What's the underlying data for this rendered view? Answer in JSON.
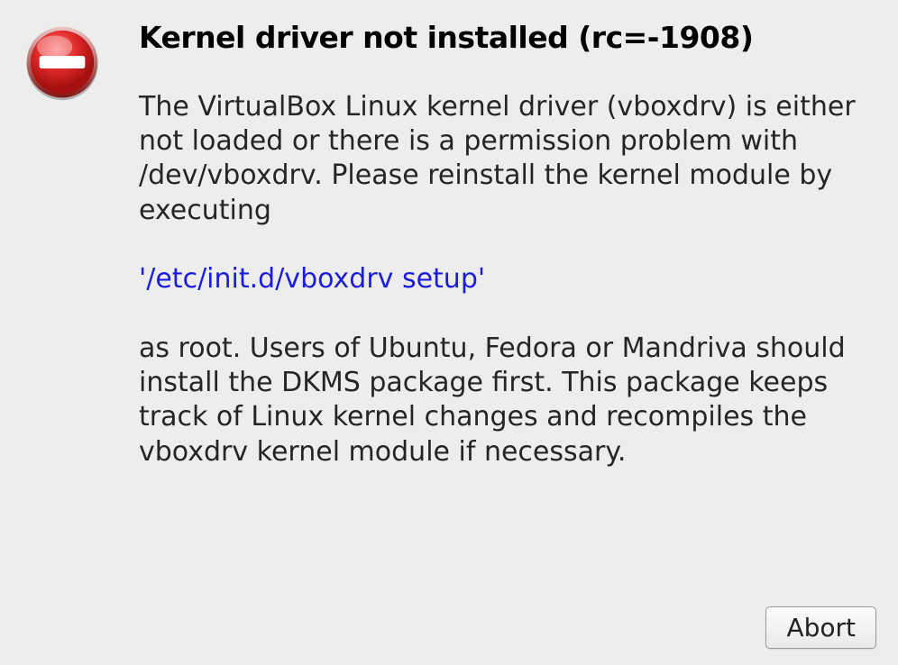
{
  "dialog": {
    "title": "Kernel driver not installed (rc=-1908)",
    "paragraph1": "The VirtualBox Linux kernel driver (vboxdrv) is either not loaded or there is a permission problem with /dev/vboxdrv. Please reinstall the kernel module by executing",
    "command": "'/etc/init.d/vboxdrv setup'",
    "paragraph2": "as root. Users of Ubuntu, Fedora or Mandriva should install the DKMS package first. This package keeps track of Linux kernel changes and recompiles the vboxdrv kernel module if necessary.",
    "abort_label": "Abort"
  },
  "icons": {
    "error": "error-icon"
  },
  "colors": {
    "link": "#1c1cdc",
    "bg": "#ededed"
  }
}
